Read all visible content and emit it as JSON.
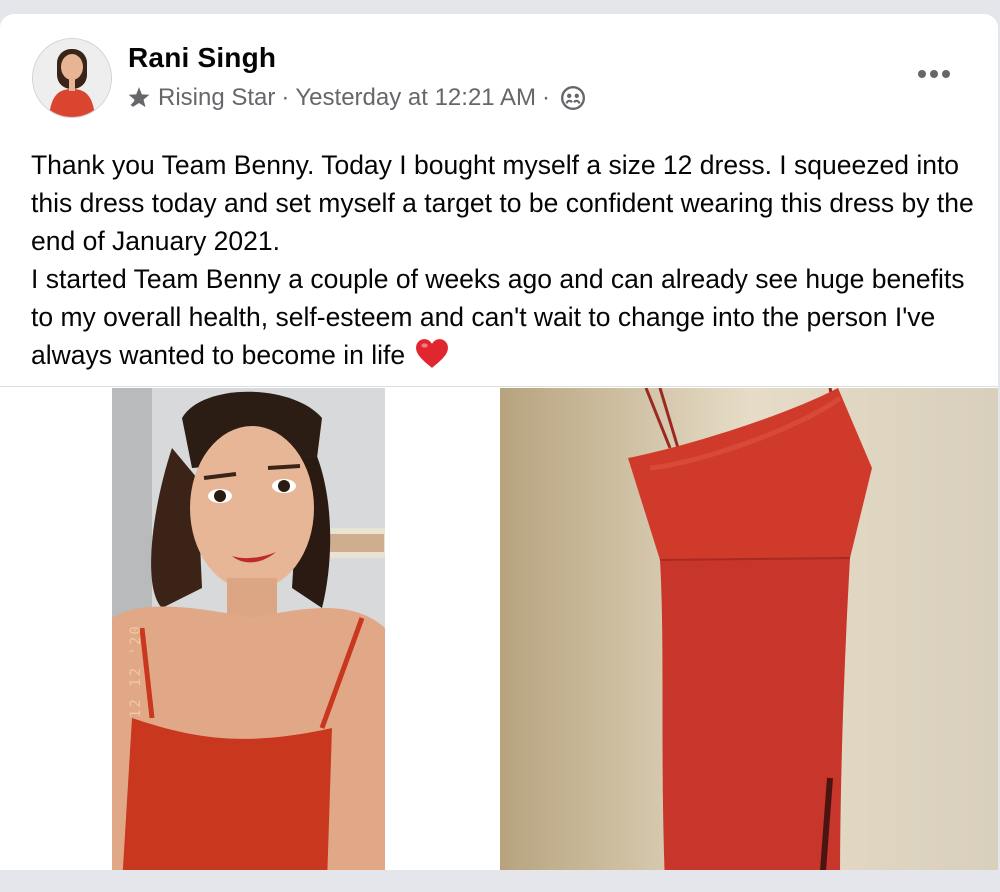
{
  "post": {
    "author": "Rani Singh",
    "badge": "Rising Star",
    "separator": "·",
    "timestamp": "Yesterday at 12:21 AM",
    "audience_icon": "group-icon",
    "badge_icon": "star-icon",
    "more_icon": "more-options-icon",
    "paragraphs": [
      "Thank you Team Benny. Today I bought myself a size 12 dress. I squeezed into this dress today and set myself a target to be confident wearing this dress by the end of January 2021.",
      "I started Team Benny a couple of weeks ago and can already see huge benefits to my overall health, self-esteem and can't wait to change into the person I've always wanted to become in life"
    ],
    "emoji": "red-heart-icon"
  },
  "photos": [
    {
      "name": "selfie-photo",
      "date_stamp": "12 12 '20"
    },
    {
      "name": "red-dress-photo"
    }
  ],
  "colors": {
    "text": "#050505",
    "secondary_text": "#65676b",
    "dress_red": "#c7352a",
    "background": "#e4e6eb"
  }
}
